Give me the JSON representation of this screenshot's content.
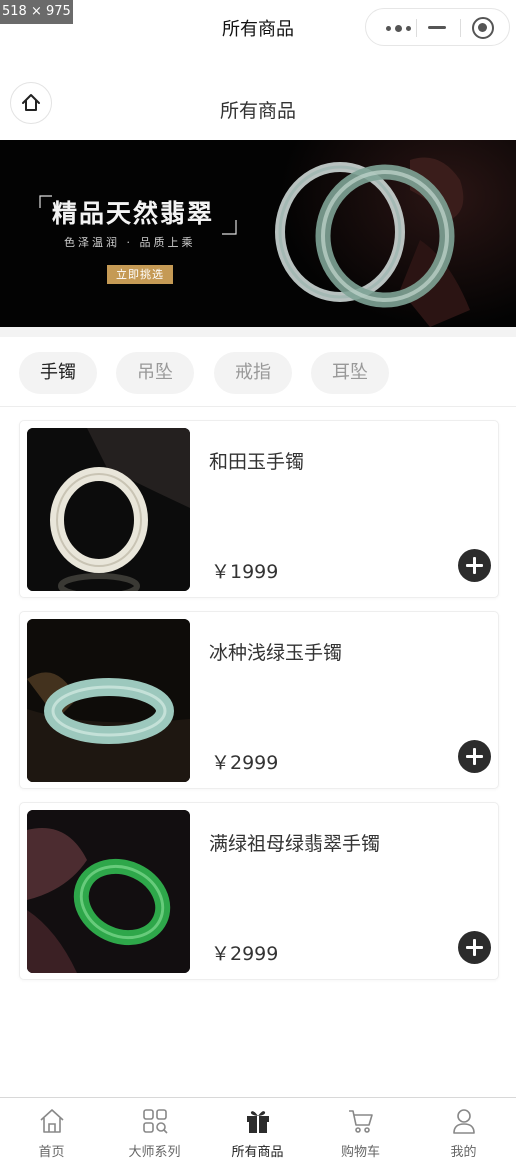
{
  "overlay_label": "518 × 975",
  "window": {
    "title": "所有商品"
  },
  "capsule": {
    "more_icon": "more-dots-icon",
    "minimize_icon": "minus-icon",
    "close_icon": "target-icon"
  },
  "navbar": {
    "title": "所有商品",
    "home_icon": "home-icon"
  },
  "banner": {
    "title": "精品天然翡翠",
    "subtitle": "色泽温润 · 品质上乘",
    "button": "立即挑选"
  },
  "categories": [
    {
      "label": "手镯",
      "active": true
    },
    {
      "label": "吊坠",
      "active": false
    },
    {
      "label": "戒指",
      "active": false
    },
    {
      "label": "耳坠",
      "active": false
    }
  ],
  "products": [
    {
      "name": "和田玉手镯",
      "price": "￥1999"
    },
    {
      "name": "冰种浅绿玉手镯",
      "price": "￥2999"
    },
    {
      "name": "满绿祖母绿翡翠手镯",
      "price": "￥2999"
    }
  ],
  "tabbar": [
    {
      "label": "首页",
      "icon": "home-outline-icon",
      "active": false
    },
    {
      "label": "大师系列",
      "icon": "grid-search-icon",
      "active": false
    },
    {
      "label": "所有商品",
      "icon": "gift-icon",
      "active": true
    },
    {
      "label": "购物车",
      "icon": "cart-icon",
      "active": false
    },
    {
      "label": "我的",
      "icon": "user-icon",
      "active": false
    }
  ],
  "colors": {
    "accent": "#2c2c2c",
    "banner_button": "#c59a55",
    "tab_bg": "#f3f3f3"
  }
}
